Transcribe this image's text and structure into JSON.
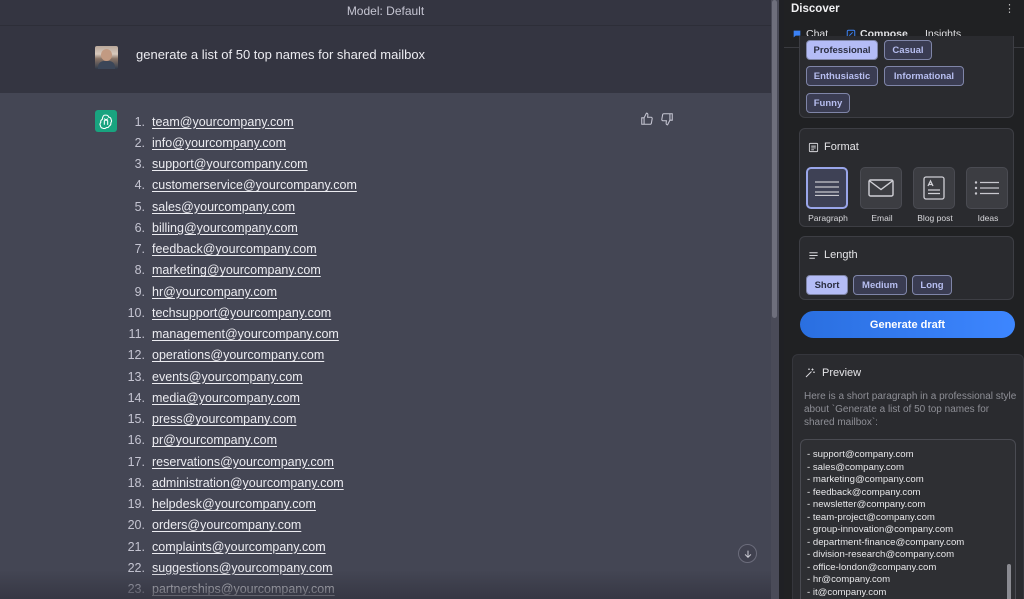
{
  "chat": {
    "model_label": "Model: Default",
    "user_prompt": "generate a list of 50 top names for shared mailbox",
    "answer_items": [
      {
        "num": "1.",
        "email": "team@yourcompany.com"
      },
      {
        "num": "2.",
        "email": "info@yourcompany.com"
      },
      {
        "num": "3.",
        "email": "support@yourcompany.com"
      },
      {
        "num": "4.",
        "email": "customerservice@yourcompany.com"
      },
      {
        "num": "5.",
        "email": "sales@yourcompany.com"
      },
      {
        "num": "6.",
        "email": "billing@yourcompany.com"
      },
      {
        "num": "7.",
        "email": "feedback@yourcompany.com"
      },
      {
        "num": "8.",
        "email": "marketing@yourcompany.com"
      },
      {
        "num": "9.",
        "email": "hr@yourcompany.com"
      },
      {
        "num": "10.",
        "email": "techsupport@yourcompany.com"
      },
      {
        "num": "11.",
        "email": "management@yourcompany.com"
      },
      {
        "num": "12.",
        "email": "operations@yourcompany.com"
      },
      {
        "num": "13.",
        "email": "events@yourcompany.com"
      },
      {
        "num": "14.",
        "email": "media@yourcompany.com"
      },
      {
        "num": "15.",
        "email": "press@yourcompany.com"
      },
      {
        "num": "16.",
        "email": "pr@yourcompany.com"
      },
      {
        "num": "17.",
        "email": "reservations@yourcompany.com"
      },
      {
        "num": "18.",
        "email": "administration@yourcompany.com"
      },
      {
        "num": "19.",
        "email": "helpdesk@yourcompany.com"
      },
      {
        "num": "20.",
        "email": "orders@yourcompany.com"
      },
      {
        "num": "21.",
        "email": "complaints@yourcompany.com"
      },
      {
        "num": "22.",
        "email": "suggestions@yourcompany.com"
      },
      {
        "num": "23.",
        "email": "partnerships@yourcompany.com"
      }
    ],
    "icons": {
      "avatar_bot": "openai-logo-icon",
      "thumbs_up": "thumbs-up-icon",
      "thumbs_down": "thumbs-down-icon",
      "scroll_down": "arrow-down-icon"
    }
  },
  "discover": {
    "title": "Discover",
    "more": "⋮",
    "tabs": [
      {
        "label": "Chat",
        "icon": "chat-bubble-icon"
      },
      {
        "label": "Compose",
        "icon": "compose-icon",
        "active": true
      },
      {
        "label": "Insights",
        "icon": ""
      }
    ],
    "tone": {
      "options": [
        "Professional",
        "Casual",
        "Enthusiastic",
        "Informational",
        "Funny"
      ],
      "selected": "Professional"
    },
    "format": {
      "title": "Format",
      "options": [
        "Paragraph",
        "Email",
        "Blog post",
        "Ideas"
      ],
      "selected": "Paragraph"
    },
    "length": {
      "title": "Length",
      "options": [
        "Short",
        "Medium",
        "Long"
      ],
      "selected": "Short"
    },
    "generate_label": "Generate draft",
    "preview": {
      "title": "Preview",
      "description": "Here is a short paragraph in a professional style about `Generate a list of 50 top names for shared mailbox`:",
      "lines": [
        "- support@company.com",
        "- sales@company.com",
        "- marketing@company.com",
        "- feedback@company.com",
        "- newsletter@company.com",
        "- team-project@company.com",
        "- group-innovation@company.com",
        "- department-finance@company.com",
        "- division-research@company.com",
        "- office-london@company.com",
        "- hr@company.com",
        "- it@company.com"
      ]
    },
    "colors": {
      "accent": "#3d86ff",
      "chip_selected": "#b4bcf6",
      "chip_border": "#7f85a8"
    }
  }
}
